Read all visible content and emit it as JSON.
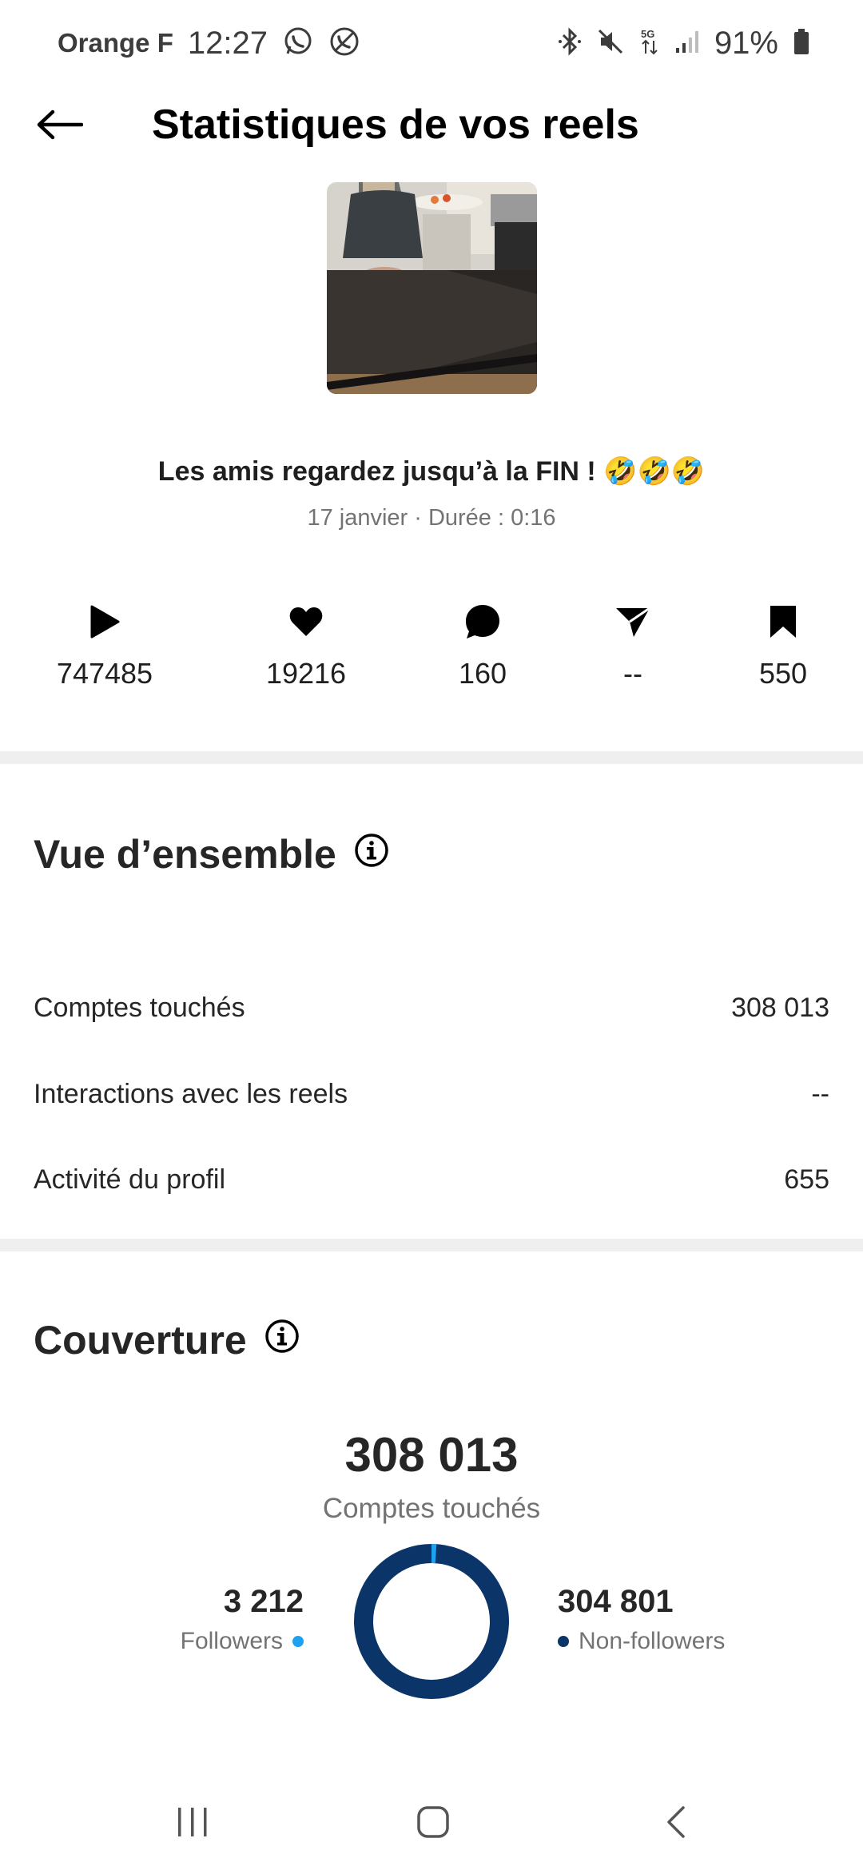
{
  "status_bar": {
    "carrier": "Orange F",
    "time": "12:27",
    "battery": "91%"
  },
  "header": {
    "title": "Statistiques de vos reels"
  },
  "reel": {
    "caption": "Les amis regardez jusqu’à la FIN ! 🤣🤣🤣",
    "meta": "17 janvier · Durée : 0:16"
  },
  "stats": {
    "plays": "747485",
    "likes": "19216",
    "comments": "160",
    "shares": "--",
    "saves": "550"
  },
  "overview": {
    "title": "Vue d’ensemble",
    "rows": [
      {
        "label": "Comptes touchés",
        "value": "308 013"
      },
      {
        "label": "Interactions avec les reels",
        "value": "--"
      },
      {
        "label": "Activité du profil",
        "value": "655"
      }
    ]
  },
  "coverage": {
    "title": "Couverture",
    "total": "308 013",
    "total_label": "Comptes touchés",
    "followers_value": "3 212",
    "followers_label": "Followers",
    "non_followers_value": "304 801",
    "non_followers_label": "Non-followers",
    "followers_fraction": 0.0104,
    "colors": {
      "followers": "#1fa1f2",
      "non_followers": "#0b3468"
    }
  },
  "icons": {
    "back": "arrow-left-icon",
    "info": "info-icon",
    "play": "play-icon",
    "like": "heart-icon",
    "comment": "comment-icon",
    "share": "send-icon",
    "save": "bookmark-icon"
  }
}
